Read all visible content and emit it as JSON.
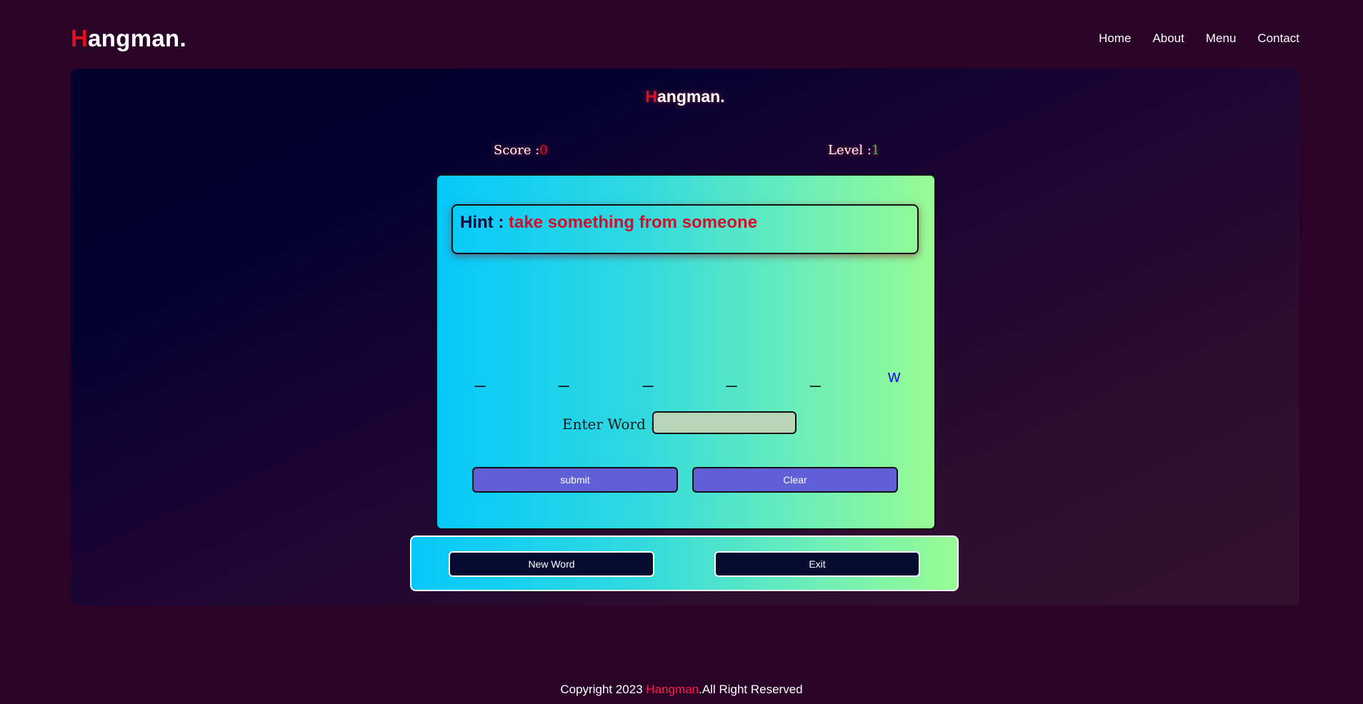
{
  "navbar": {
    "logo_first": "H",
    "logo_rest": "angman.",
    "links": [
      "Home",
      "About",
      "Menu",
      "Contact"
    ]
  },
  "game": {
    "title_first": "H",
    "title_rest": "angman.",
    "score_label": "Score :",
    "score_value": "0",
    "level_label": "Level :",
    "level_value": "1",
    "hint_label": "Hint : ",
    "hint_value": "take something from someone",
    "letters": [
      "_",
      "_",
      "_",
      "_",
      "_",
      "w"
    ],
    "enter_word_label": "Enter Word :",
    "word_input_value": "",
    "submit_label": "submit",
    "clear_label": "Clear"
  },
  "actions": {
    "new_word_label": "New Word",
    "exit_label": "Exit"
  },
  "footer": {
    "prefix": "Copyright 2023 ",
    "brand": "Hangman",
    "suffix": ".All Right Reserved"
  },
  "colors": {
    "page_background": "#2a0428",
    "accent_red": "#e0101a",
    "level_green": "#34c759",
    "revealed_letter": "#1414e0",
    "card_gradient_start": "#05c8fb",
    "card_gradient_end": "#97fb93",
    "card_button": "#5f5fd8",
    "action_button": "#060c30"
  }
}
